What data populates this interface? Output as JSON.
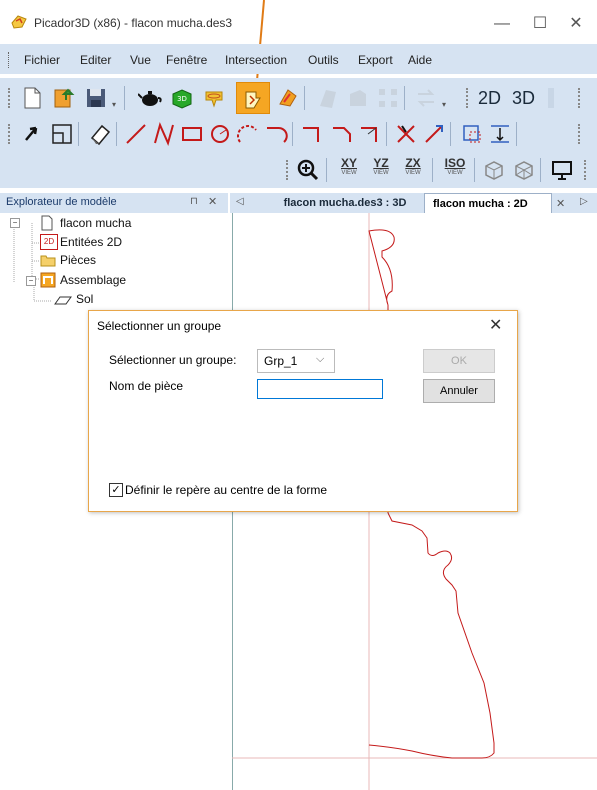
{
  "window": {
    "title": "Picador3D (x86) - flacon mucha.des3",
    "minimize": "—",
    "maximize": "☐",
    "close": "✕"
  },
  "menu": [
    "Fichier",
    "Editer",
    "Vue",
    "Fenêtre",
    "Intersection",
    "Outils",
    "Export",
    "Aide"
  ],
  "toolbar1": {
    "view2d_label": "2D",
    "view3d_label": "3D"
  },
  "toolbar3": {
    "xy_label": "XY",
    "yz_label": "YZ",
    "zx_label": "ZX",
    "iso_label": "ISO",
    "view_sub": "VIEW"
  },
  "sidebar": {
    "header": "Explorateur de modèle",
    "pin": "⊓",
    "close": "✕",
    "tree": {
      "root": "flacon mucha",
      "entities2d": "Entitées 2D",
      "pieces": "Pièces",
      "assemblage": "Assemblage",
      "sol": "Sol"
    }
  },
  "tabs": {
    "left_arrow": "◁",
    "tab1": "flacon mucha.des3 : 3D",
    "tab2": "flacon mucha : 2D",
    "tab2_close": "✕",
    "right_arrow": "▷"
  },
  "dialog": {
    "title": "Sélectionner un groupe",
    "close": "✕",
    "group_label": "Sélectionner un groupe:",
    "group_value": "Grp_1",
    "part_name_label": "Nom de pièce",
    "part_name_value": "",
    "ok_label": "OK",
    "cancel_label": "Annuler",
    "checkbox_label": "Définir le repère au centre de la forme",
    "checkbox_checked": true
  },
  "colors": {
    "toolbar_bg": "#d6e3f2",
    "active_tool": "#f5a623",
    "dialog_border": "#e8a64a",
    "profile_line": "#c0392b",
    "annotation_arrow": "#e07b16"
  }
}
